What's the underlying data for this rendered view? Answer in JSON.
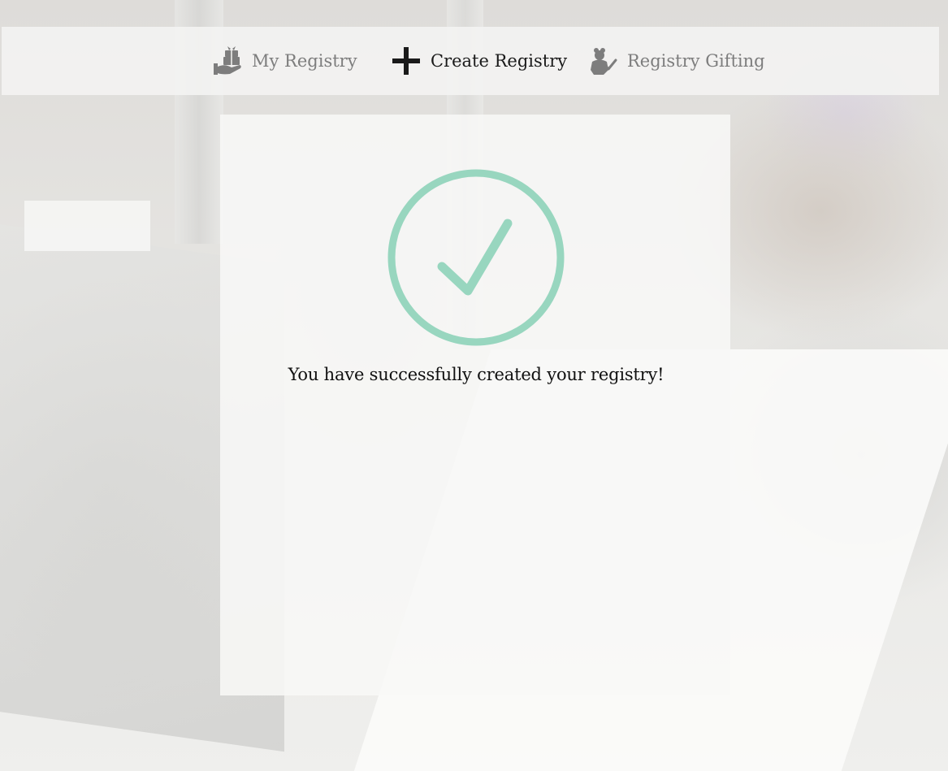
{
  "nav": {
    "items": [
      {
        "label": "My Registry",
        "icon": "gift-stack-icon",
        "active": false
      },
      {
        "label": "Create Registry",
        "icon": "plus-icon",
        "active": true
      },
      {
        "label": "Registry Gifting",
        "icon": "gift-bear-icon",
        "active": false
      }
    ]
  },
  "confirmation": {
    "icon": "check-circle-icon",
    "message": "You have successfully created your registry!"
  },
  "colors": {
    "accent": "#98d6bf",
    "active_nav": "#1a1a1a",
    "inactive_nav": "#7d7d7d"
  }
}
